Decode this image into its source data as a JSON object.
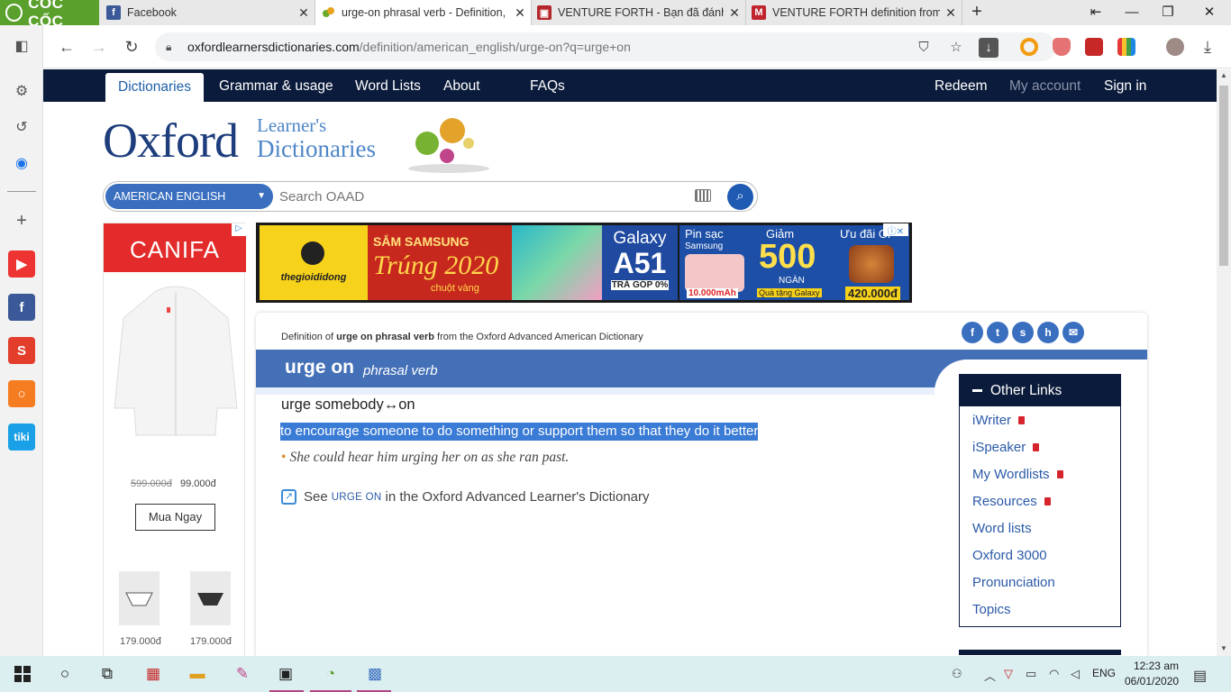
{
  "browser": {
    "brand": "CỐC CỐC",
    "tabs": [
      {
        "label": "Facebook",
        "icon": "facebook-icon"
      },
      {
        "label": "urge-on phrasal verb - Definition, p",
        "icon": "oxford-icon",
        "active": true
      },
      {
        "label": "VENTURE FORTH - Bạn đã đánh vần",
        "icon": "cambridge-icon"
      },
      {
        "label": "VENTURE FORTH definition from M",
        "icon": "macmillan-icon"
      }
    ],
    "url_host": "oxfordlearnersdictionaries.com",
    "url_path": "/definition/american_english/urge-on?q=urge+on"
  },
  "oxford_nav": {
    "items": [
      "Dictionaries",
      "Grammar & usage",
      "Word Lists",
      "About",
      "FAQs"
    ],
    "right": [
      "Redeem",
      "My account",
      "Sign in"
    ]
  },
  "logo": {
    "oxford": "Oxford",
    "line1": "Learner's",
    "line2": "Dictionaries"
  },
  "search": {
    "dictionary": "AMERICAN ENGLISH",
    "placeholder": "Search OAAD"
  },
  "left_ad": {
    "brand": "CANIFA",
    "price_old": "599.000đ",
    "price_new": "99.000đ",
    "button": "Mua Ngay",
    "thumb_prices": [
      "179.000đ",
      "179.000đ"
    ]
  },
  "banner_ad": {
    "store": "thegioididong",
    "promo1": "SẮM SAMSUNG",
    "promo2": "Trúng 2020",
    "promo3": "chuột vàng",
    "model1": "Galaxy",
    "model2": "A51",
    "installment": "TRẢ GÓP 0%",
    "pin1": "Pin sạc",
    "pin2": "Samsung",
    "pin3": "10.000mAh",
    "giam1": "Giảm",
    "giam2": "500",
    "giam3": "NGÀN",
    "giam4": "Quà tặng Galaxy",
    "uudai1": "Ưu đãi Gi",
    "uudai2": "420.000đ"
  },
  "entry": {
    "definition_of_prefix": "Definition of",
    "definition_of_word": "urge on phrasal verb",
    "definition_of_suffix": "from the Oxford Advanced American Dictionary",
    "headword": "urge on",
    "pos": "phrasal verb",
    "usage": "urge somebody↔on",
    "definition": "to encourage someone to do something or support them so that they do it better",
    "example": "She could hear him urging her on as she ran past.",
    "see_prefix": "See",
    "see_xref": "URGE ON",
    "see_suffix": "in the Oxford Advanced Learner's Dictionary",
    "share": [
      "f",
      "t",
      "s",
      "h",
      "✉"
    ]
  },
  "other_links": {
    "title": "Other Links",
    "items": [
      {
        "label": "iWriter",
        "locked": true
      },
      {
        "label": "iSpeaker",
        "locked": true
      },
      {
        "label": "My Wordlists",
        "locked": true
      },
      {
        "label": "Resources",
        "locked": true
      },
      {
        "label": "Word lists",
        "locked": false
      },
      {
        "label": "Oxford 3000",
        "locked": false
      },
      {
        "label": "Pronunciation",
        "locked": false
      },
      {
        "label": "Topics",
        "locked": false
      }
    ]
  },
  "taskbar": {
    "lang": "ENG",
    "time": "12:23 am",
    "date": "06/01/2020"
  },
  "colors": {
    "oxford_navy": "#0b1b3b",
    "entry_blue": "#4470b7",
    "link_blue": "#2b5aa8",
    "coccoc_green": "#5aa02c"
  }
}
